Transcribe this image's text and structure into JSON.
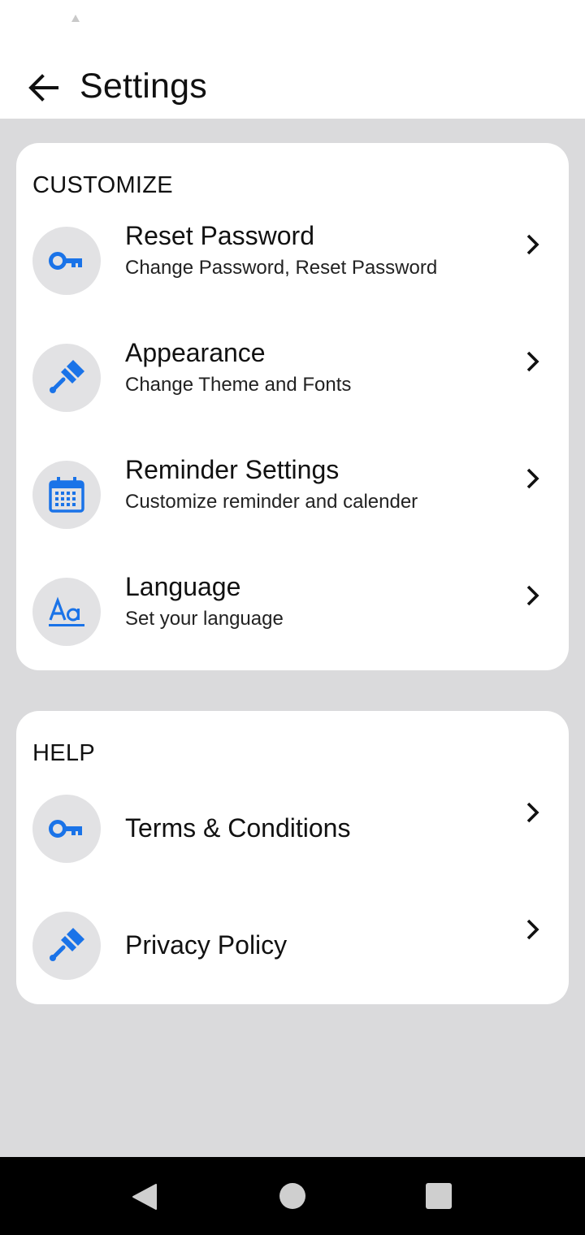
{
  "app_bar": {
    "title": "Settings",
    "back_icon": "arrow-left-icon"
  },
  "customize": {
    "title": "CUSTOMIZE",
    "items": [
      {
        "title": "Reset Password",
        "subtitle": "Change Password, Reset Password",
        "icon": "key-icon"
      },
      {
        "title": "Appearance",
        "subtitle": "Change Theme and Fonts",
        "icon": "paintbrush-icon"
      },
      {
        "title": "Reminder Settings",
        "subtitle": "Customize reminder and calender",
        "icon": "calendar-icon"
      },
      {
        "title": "Language",
        "subtitle": "Set your language",
        "icon": "text-format-icon"
      }
    ]
  },
  "help": {
    "title": "HELP",
    "items": [
      {
        "title": "Terms & Conditions",
        "icon": "key-icon"
      },
      {
        "title": "Privacy Policy",
        "icon": "paintbrush-icon"
      }
    ]
  },
  "colors": {
    "accent": "#1a73e8",
    "background": "#dadadc",
    "card": "#ffffff",
    "icon_circle": "#e2e2e4"
  }
}
